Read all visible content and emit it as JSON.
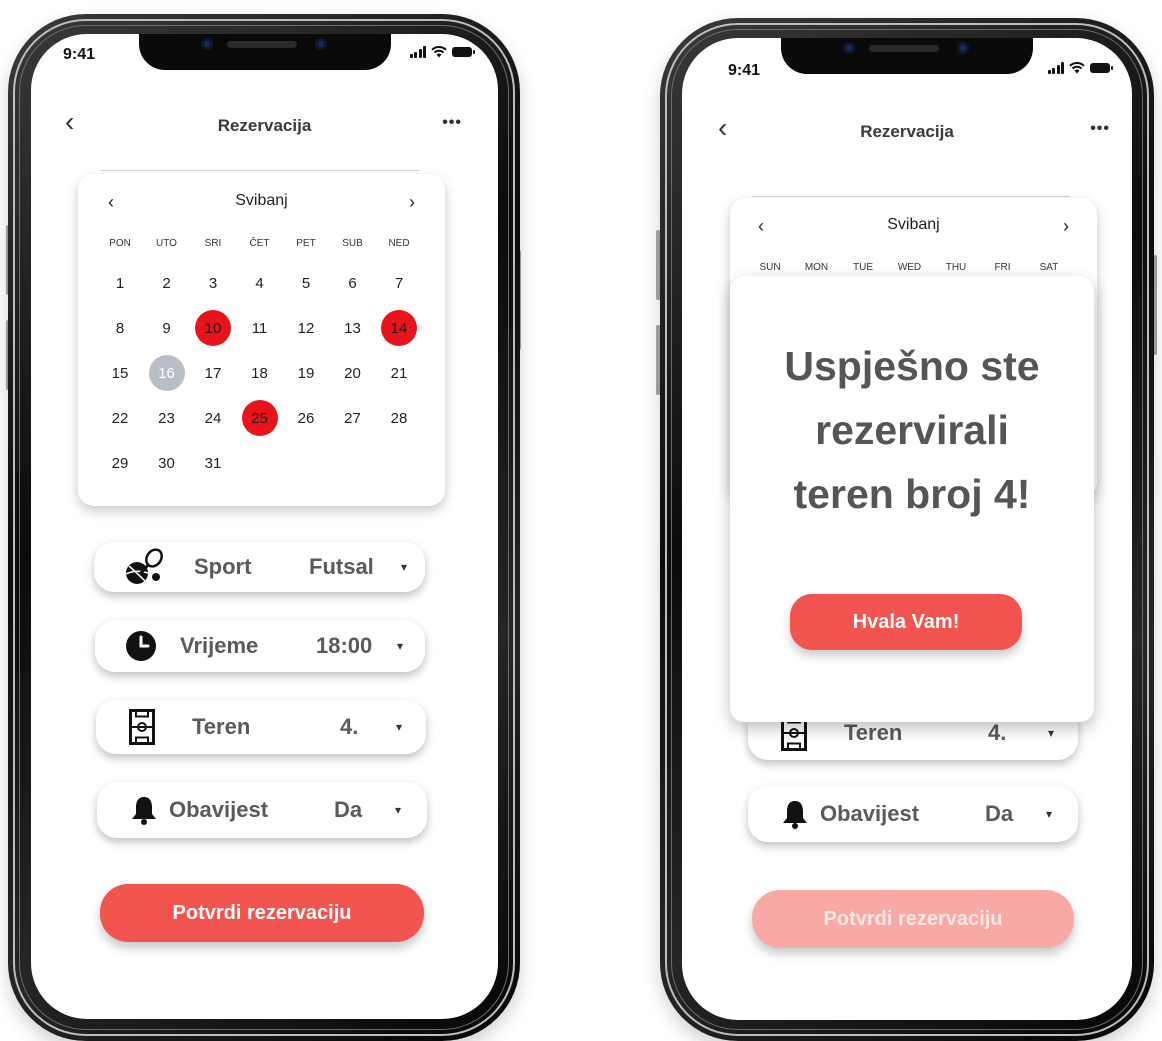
{
  "status_time": "9:41",
  "nav": {
    "back_glyph": "‹",
    "title": "Rezervacija",
    "more_glyph": "•••"
  },
  "colors": {
    "accent": "#f25450",
    "booked": "#e8131b",
    "today": "#b9bec6"
  },
  "left_phone": {
    "calendar": {
      "prev_glyph": "‹",
      "next_glyph": "›",
      "month": "Svibanj",
      "weekdays": [
        "PON",
        "UTO",
        "SRI",
        "ČET",
        "PET",
        "SUB",
        "NED"
      ],
      "days": [
        "1",
        "2",
        "3",
        "4",
        "5",
        "6",
        "7",
        "8",
        "9",
        "10",
        "11",
        "12",
        "13",
        "14",
        "15",
        "16",
        "17",
        "18",
        "19",
        "20",
        "21",
        "22",
        "23",
        "24",
        "25",
        "26",
        "27",
        "28",
        "29",
        "30",
        "31"
      ],
      "booked_days": [
        "10",
        "14",
        "25"
      ],
      "today": "16"
    },
    "options": {
      "sport": {
        "icon": "sport-balls-icon",
        "label": "Sport",
        "value": "Futsal"
      },
      "time": {
        "icon": "clock-icon",
        "label": "Vrijeme",
        "value": "18:00"
      },
      "court": {
        "icon": "court-field-icon",
        "label": "Teren",
        "value": "4."
      },
      "notification": {
        "icon": "bell-icon",
        "label": "Obavijest",
        "value": "Da"
      }
    },
    "caret": "▾",
    "confirm_label": "Potvrdi rezervaciju"
  },
  "right_phone": {
    "calendar": {
      "prev_glyph": "‹",
      "next_glyph": "›",
      "month": "Svibanj",
      "weekdays": [
        "SUN",
        "MON",
        "TUE",
        "WED",
        "THU",
        "FRI",
        "SAT"
      ]
    },
    "dialog": {
      "line1": "Uspješno ste",
      "line2": "rezervirali",
      "line3": "teren broj 4!",
      "button_label": "Hvala Vam!"
    },
    "options": {
      "court": {
        "icon": "court-field-icon",
        "label": "Teren",
        "value": "4."
      },
      "notification": {
        "icon": "bell-icon",
        "label": "Obavijest",
        "value": "Da"
      }
    },
    "caret": "▾",
    "confirm_label": "Potvrdi rezervaciju"
  }
}
